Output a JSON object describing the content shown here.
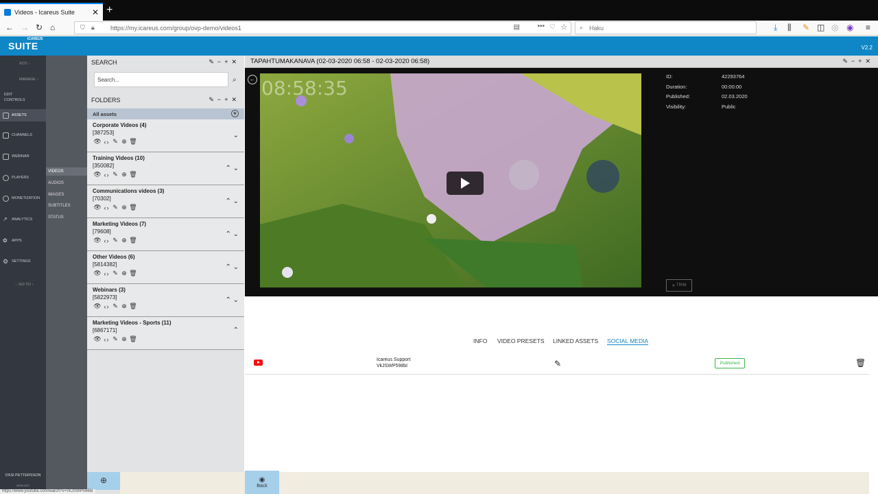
{
  "browser": {
    "tab_title": "Videos - Icareus Suite",
    "new_tab": "+",
    "url": "https://my.icareus.com/group/ovp-demo/videos1",
    "search_placeholder": "Haku",
    "status_url": "https://www.youtube.com/watch?v=VkJSWP598bI"
  },
  "app": {
    "logo_small": "ICAREUS",
    "logo": "SUITE",
    "version": "V2.2"
  },
  "leftnav": {
    "items": [
      {
        "label": "ADD",
        "icon": "add-icon"
      },
      {
        "label": "MANAGE",
        "icon": "manage-icon"
      },
      {
        "label": "EDIT CONTROLS",
        "icon": "edit-controls-icon"
      },
      {
        "label": "ASSETS",
        "icon": "assets-icon"
      },
      {
        "label": "CHANNELS",
        "icon": "channels-icon"
      },
      {
        "label": "WEBINAR",
        "icon": "webinar-icon"
      },
      {
        "label": "PLAYERS",
        "icon": "players-icon"
      },
      {
        "label": "MONETIZATION",
        "icon": "monetization-icon"
      },
      {
        "label": "ANALYTICS",
        "icon": "analytics-icon"
      },
      {
        "label": "APPS",
        "icon": "apps-icon"
      },
      {
        "label": "SETTINGS",
        "icon": "settings-icon"
      },
      {
        "label": "GO TO",
        "icon": "goto-icon"
      }
    ],
    "user": "OSSI PETTERSSON",
    "signout": "SIGN OUT"
  },
  "subnav": {
    "items": [
      "VIDEOS",
      "AUDIOS",
      "IMAGES",
      "SUBTITLES",
      "STATUS"
    ]
  },
  "search": {
    "title": "SEARCH",
    "placeholder": "Search..."
  },
  "folders": {
    "title": "FOLDERS",
    "all_assets": "All assets",
    "items": [
      {
        "name": "Corporate Videos (4)",
        "id": "[387253]"
      },
      {
        "name": "Training Videos (10)",
        "id": "[350082]"
      },
      {
        "name": "Communications videos (3)",
        "id": "[70302]"
      },
      {
        "name": "Marketing Videos (7)",
        "id": "[79608]"
      },
      {
        "name": "Other Videos (6)",
        "id": "[5814382]"
      },
      {
        "name": "Webinars (3)",
        "id": "[5822973]"
      },
      {
        "name": "Marketing Videos - Sports (11)",
        "id": "[6867171]"
      }
    ]
  },
  "main": {
    "title": "TAPAHTUMAKANAVA (02-03-2020 06:58 - 02-03-2020 06:58)",
    "timecode": "08:58:35",
    "meta": {
      "id_label": "ID:",
      "id_value": "42293764",
      "duration_label": "Duration:",
      "duration_value": "00:00:00",
      "published_label": "Published:",
      "published_value": "02.03.2020",
      "visibility_label": "Visibility:",
      "visibility_value": "Public"
    },
    "trim": "TRIM",
    "tabs": [
      "INFO",
      "VIDEO PRESETS",
      "LINKED ASSETS",
      "SOCIAL MEDIA"
    ],
    "social": {
      "account": "Icareus Support",
      "video_id": "VkJSWP598bI",
      "status": "Published"
    },
    "back": "Back"
  }
}
